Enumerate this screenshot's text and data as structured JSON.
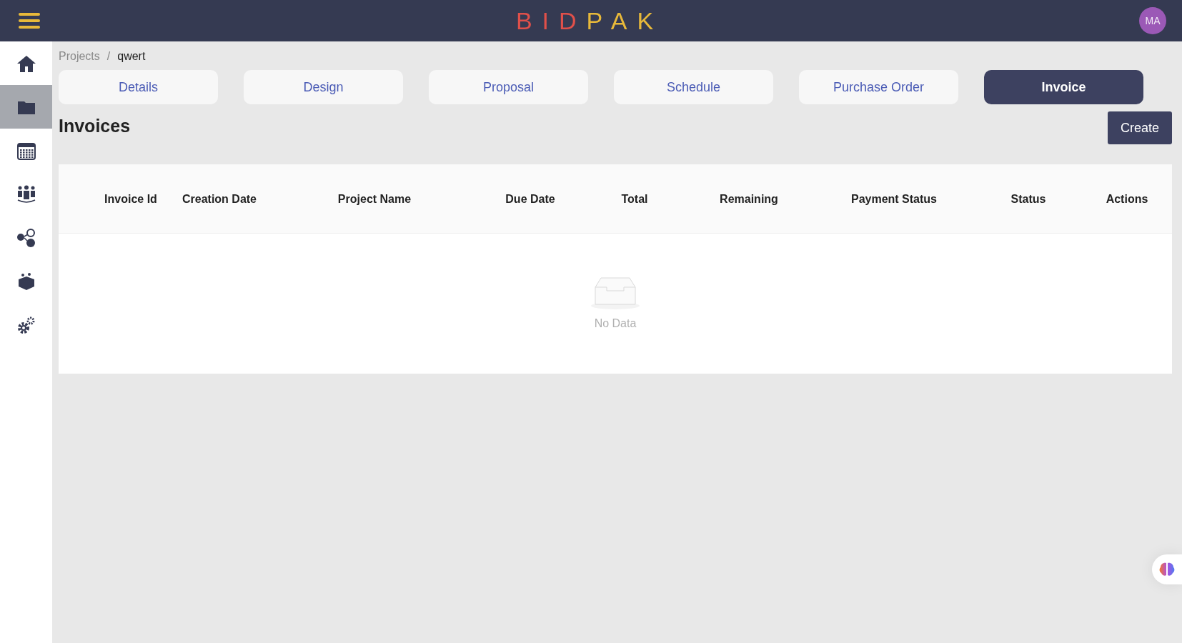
{
  "header": {
    "logo": [
      {
        "text": "BID",
        "color": "#e0504a"
      },
      {
        "text": "PAK",
        "color": "#e8b93a"
      }
    ],
    "avatar": "MA"
  },
  "sidebar": {
    "items": [
      {
        "kind": "home",
        "selected": false
      },
      {
        "kind": "folder",
        "selected": true
      },
      {
        "kind": "calendar",
        "selected": false
      },
      {
        "kind": "team",
        "selected": false
      },
      {
        "kind": "finance",
        "selected": false
      },
      {
        "kind": "box",
        "selected": false
      },
      {
        "kind": "gears",
        "selected": false
      }
    ]
  },
  "breadcrumb": {
    "link": "Projects",
    "separator": "/",
    "current": "qwert"
  },
  "tabs": [
    {
      "label": "Details",
      "selected": false
    },
    {
      "label": "Design",
      "selected": false
    },
    {
      "label": "Proposal",
      "selected": false
    },
    {
      "label": "Schedule",
      "selected": false
    },
    {
      "label": "Purchase Order",
      "selected": false
    },
    {
      "label": "Invoice",
      "selected": true
    }
  ],
  "page_title": "Invoices",
  "create_button": "Create",
  "table": {
    "columns": [
      "Invoice Id",
      "Creation Date",
      "Project Name",
      "Due Date",
      "Total",
      "Remaining",
      "Payment Status",
      "Status",
      "Actions"
    ],
    "empty_text": "No Data"
  }
}
